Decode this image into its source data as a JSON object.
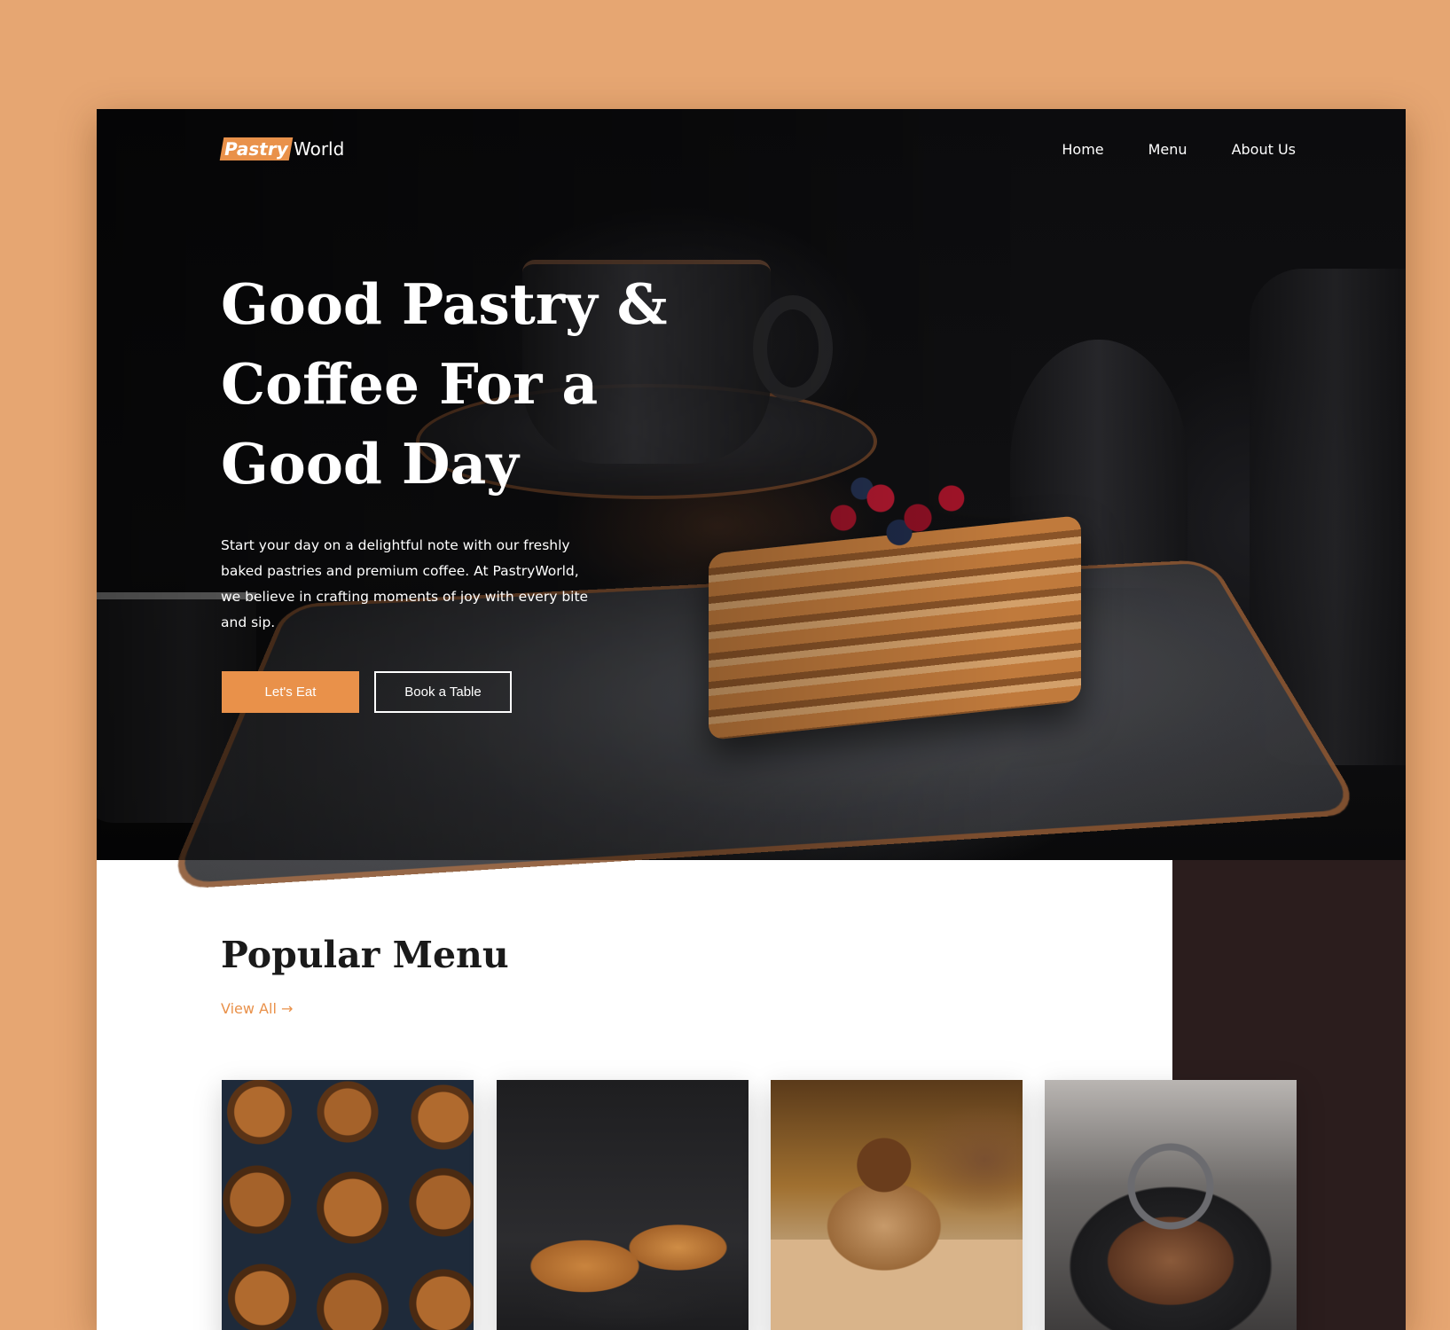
{
  "brand": {
    "part1": "Pastry",
    "part2": "World"
  },
  "nav": {
    "items": [
      {
        "label": "Home"
      },
      {
        "label": "Menu"
      },
      {
        "label": "About Us"
      }
    ]
  },
  "hero": {
    "title": "Good Pastry & Coffee For a Good Day",
    "description": "Start your day on a delightful note with our freshly baked pastries and premium coffee. At PastryWorld, we believe in crafting moments of joy with every bite and sip.",
    "primary_button": "Let's Eat",
    "secondary_button": "Book a Table"
  },
  "popular_menu": {
    "title": "Popular Menu",
    "view_all": "View All →"
  },
  "colors": {
    "accent": "#e9914a",
    "page_background": "#e6a672",
    "dark_panel": "#2b1d1d"
  }
}
